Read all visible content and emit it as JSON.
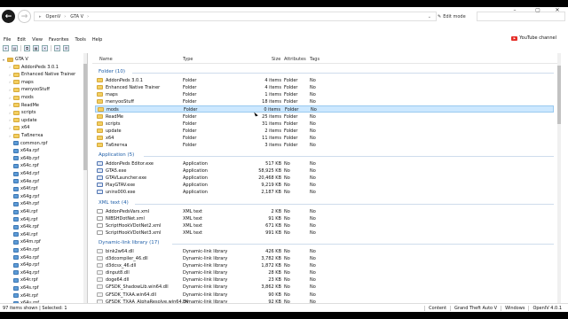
{
  "titlebar": {
    "address_root": "OpenV",
    "address_current": "GTA V",
    "edit_mode_label": "Edit mode",
    "minimize": "–",
    "maximize": "▢",
    "close": "✕"
  },
  "menu": {
    "items": [
      "File",
      "Edit",
      "View",
      "Favorites",
      "Tools",
      "Help"
    ],
    "youtube_label": "YouTube channel"
  },
  "sidebar": {
    "items": [
      {
        "label": "GTA V",
        "type": "root"
      },
      {
        "label": "AddonPeds 3.0.1",
        "type": "folder"
      },
      {
        "label": "Enhanced Native Trainer",
        "type": "folder"
      },
      {
        "label": "maps",
        "type": "folder"
      },
      {
        "label": "menyooStuff",
        "type": "folder"
      },
      {
        "label": "mods",
        "type": "folder"
      },
      {
        "label": "ReadMe",
        "type": "folder"
      },
      {
        "label": "scripts",
        "type": "folder"
      },
      {
        "label": "update",
        "type": "folder"
      },
      {
        "label": "x64",
        "type": "folder"
      },
      {
        "label": "Таблетка",
        "type": "folder"
      },
      {
        "label": "common.rpf",
        "type": "rpf"
      },
      {
        "label": "x64a.rpf",
        "type": "rpf"
      },
      {
        "label": "x64b.rpf",
        "type": "rpf"
      },
      {
        "label": "x64c.rpf",
        "type": "rpf"
      },
      {
        "label": "x64d.rpf",
        "type": "rpf"
      },
      {
        "label": "x64e.rpf",
        "type": "rpf"
      },
      {
        "label": "x64f.rpf",
        "type": "rpf"
      },
      {
        "label": "x64g.rpf",
        "type": "rpf"
      },
      {
        "label": "x64h.rpf",
        "type": "rpf"
      },
      {
        "label": "x64i.rpf",
        "type": "rpf"
      },
      {
        "label": "x64j.rpf",
        "type": "rpf"
      },
      {
        "label": "x64k.rpf",
        "type": "rpf"
      },
      {
        "label": "x64l.rpf",
        "type": "rpf"
      },
      {
        "label": "x64m.rpf",
        "type": "rpf"
      },
      {
        "label": "x64n.rpf",
        "type": "rpf"
      },
      {
        "label": "x64o.rpf",
        "type": "rpf"
      },
      {
        "label": "x64p.rpf",
        "type": "rpf"
      },
      {
        "label": "x64q.rpf",
        "type": "rpf"
      },
      {
        "label": "x64r.rpf",
        "type": "rpf"
      },
      {
        "label": "x64s.rpf",
        "type": "rpf"
      },
      {
        "label": "x64t.rpf",
        "type": "rpf"
      },
      {
        "label": "x64u.rpf",
        "type": "rpf"
      }
    ]
  },
  "columns": {
    "name": "Name",
    "type": "Type",
    "size": "Size",
    "attributes": "Attributes",
    "tags": "Tags"
  },
  "groups": [
    {
      "header": "Folder (10)",
      "icon": "folder",
      "rows": [
        {
          "name": "AddonPeds 3.0.1",
          "type": "Folder",
          "size": "4 items",
          "attr": "Folder",
          "tags": "No"
        },
        {
          "name": "Enhanced Native Trainer",
          "type": "Folder",
          "size": "4 items",
          "attr": "Folder",
          "tags": "No"
        },
        {
          "name": "maps",
          "type": "Folder",
          "size": "1 items",
          "attr": "Folder",
          "tags": "No"
        },
        {
          "name": "menyooStuff",
          "type": "Folder",
          "size": "18 items",
          "attr": "Folder",
          "tags": "No"
        },
        {
          "name": "mods",
          "type": "Folder",
          "size": "0 items",
          "attr": "Folder",
          "tags": "No",
          "selected": true
        },
        {
          "name": "ReadMe",
          "type": "Folder",
          "size": "25 items",
          "attr": "Folder",
          "tags": "No"
        },
        {
          "name": "scripts",
          "type": "Folder",
          "size": "31 items",
          "attr": "Folder",
          "tags": "No"
        },
        {
          "name": "update",
          "type": "Folder",
          "size": "2 items",
          "attr": "Folder",
          "tags": "No"
        },
        {
          "name": "x64",
          "type": "Folder",
          "size": "11 items",
          "attr": "Folder",
          "tags": "No"
        },
        {
          "name": "Таблетка",
          "type": "Folder",
          "size": "3 items",
          "attr": "Folder",
          "tags": "No"
        }
      ]
    },
    {
      "header": "Application (5)",
      "icon": "exe",
      "rows": [
        {
          "name": "AddonPeds Editor.exe",
          "type": "Application",
          "size": "517 KB",
          "attr": "No",
          "tags": "No"
        },
        {
          "name": "GTA5.exe",
          "type": "Application",
          "size": "58,925 KB",
          "attr": "No",
          "tags": "No"
        },
        {
          "name": "GTAVLauncher.exe",
          "type": "Application",
          "size": "20,468 KB",
          "attr": "No",
          "tags": "No"
        },
        {
          "name": "PlayGTAV.exe",
          "type": "Application",
          "size": "9,219 KB",
          "attr": "No",
          "tags": "No"
        },
        {
          "name": "unins000.exe",
          "type": "Application",
          "size": "2,187 KB",
          "attr": "No",
          "tags": "No"
        }
      ]
    },
    {
      "header": "XML text (4)",
      "icon": "xml",
      "rows": [
        {
          "name": "AddonPedsVars.xml",
          "type": "XML text",
          "size": "2 KB",
          "attr": "No",
          "tags": "No"
        },
        {
          "name": "NIBSHDotNet.xml",
          "type": "XML text",
          "size": "91 KB",
          "attr": "No",
          "tags": "No"
        },
        {
          "name": "ScriptHookVDotNet2.xml",
          "type": "XML text",
          "size": "671 KB",
          "attr": "No",
          "tags": "No"
        },
        {
          "name": "ScriptHookVDotNet3.xml",
          "type": "XML text",
          "size": "991 KB",
          "attr": "No",
          "tags": "No"
        }
      ]
    },
    {
      "header": "Dynamic-link library (17)",
      "icon": "dll",
      "rows": [
        {
          "name": "bink2w64.dll",
          "type": "Dynamic-link library",
          "size": "426 KB",
          "attr": "No",
          "tags": "No"
        },
        {
          "name": "d3dcompiler_46.dll",
          "type": "Dynamic-link library",
          "size": "3,782 KB",
          "attr": "No",
          "tags": "No"
        },
        {
          "name": "d3dcsx_46.dll",
          "type": "Dynamic-link library",
          "size": "1,872 KB",
          "attr": "No",
          "tags": "No"
        },
        {
          "name": "dinput8.dll",
          "type": "Dynamic-link library",
          "size": "28 KB",
          "attr": "No",
          "tags": "No"
        },
        {
          "name": "doge64.dll",
          "type": "Dynamic-link library",
          "size": "23 KB",
          "attr": "No",
          "tags": "No"
        },
        {
          "name": "GFSDK_ShadowLib.win64.dll",
          "type": "Dynamic-link library",
          "size": "3,862 KB",
          "attr": "No",
          "tags": "No"
        },
        {
          "name": "GFSDK_TXAA.win64.dll",
          "type": "Dynamic-link library",
          "size": "90 KB",
          "attr": "No",
          "tags": "No"
        },
        {
          "name": "GFSDK_TXAA_AlphaResolve.win64.dll",
          "type": "Dynamic-link library",
          "size": "92 KB",
          "attr": "No",
          "tags": "No"
        }
      ]
    }
  ],
  "statusbar": {
    "left": "97 items shown | Selected: 1",
    "content": "Content",
    "game": "Grand Theft Auto V",
    "os": "Windows",
    "version": "OpenIV 4.0.1"
  }
}
